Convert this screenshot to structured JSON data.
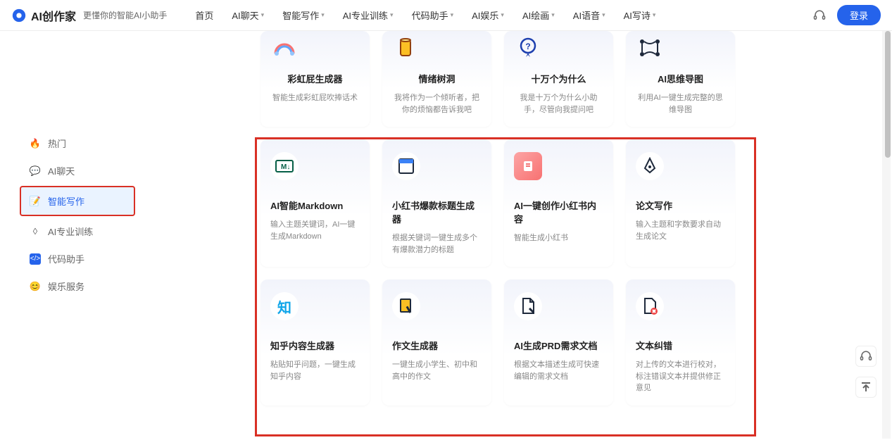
{
  "header": {
    "logo": "AI创作家",
    "subtitle": "更懂你的智能AI小助手",
    "nav": [
      "首页",
      "AI聊天",
      "智能写作",
      "AI专业训练",
      "代码助手",
      "AI娱乐",
      "AI绘画",
      "AI语音",
      "AI写诗"
    ],
    "login": "登录"
  },
  "sidebar": [
    {
      "label": "热门"
    },
    {
      "label": "AI聊天"
    },
    {
      "label": "智能写作"
    },
    {
      "label": "AI专业训练"
    },
    {
      "label": "代码助手"
    },
    {
      "label": "娱乐服务"
    }
  ],
  "row0": [
    {
      "title": "彩虹屁生成器",
      "desc": "智能生成彩虹屁吹捧话术"
    },
    {
      "title": "情绪树洞",
      "desc": "我将作为一个倾听者，把你的烦恼都告诉我吧"
    },
    {
      "title": "十万个为什么",
      "desc": "我是十万个为什么小助手，尽管向我提问吧"
    },
    {
      "title": "AI思维导图",
      "desc": "利用AI一键生成完整的思维导图"
    }
  ],
  "row1": [
    {
      "title": "AI智能Markdown",
      "desc": "输入主题关键词，AI一键生成Markdown"
    },
    {
      "title": "小红书爆款标题生成器",
      "desc": "根据关键词一键生成多个有爆款潜力的标题"
    },
    {
      "title": "AI一键创作小红书内容",
      "desc": "智能生成小红书"
    },
    {
      "title": "论文写作",
      "desc": "输入主题和字数要求自动生成论文"
    }
  ],
  "row2": [
    {
      "title": "知乎内容生成器",
      "desc": "粘贴知乎问题，一键生成知乎内容"
    },
    {
      "title": "作文生成器",
      "desc": "一键生成小学生、初中和高中的作文"
    },
    {
      "title": "AI生成PRD需求文档",
      "desc": "根据文本描述生成可快速编辑的需求文档"
    },
    {
      "title": "文本纠错",
      "desc": "对上传的文本进行校对，标注错误文本并提供修正意见"
    }
  ]
}
